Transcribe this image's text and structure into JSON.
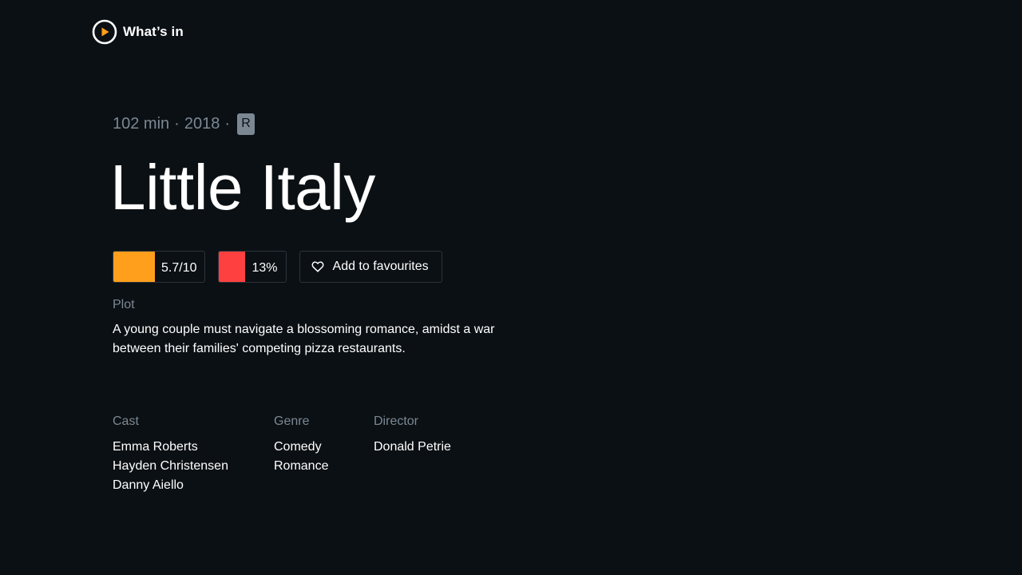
{
  "app": {
    "name": "What’s in",
    "colors": {
      "background": "#0b1014",
      "accent": "#ff9f1c",
      "muted": "#7b8894"
    }
  },
  "movie": {
    "runtime": "102 min",
    "separator1": "·",
    "year": "2018",
    "separator2": "·",
    "rating": "R",
    "title": "Little Italy",
    "imdb": {
      "value": "5.7/10",
      "color": "#ff9f1c"
    },
    "rotten": {
      "value": "13%",
      "color": "#ff4040"
    },
    "favourite_label": "Add to favourites",
    "plot_label": "Plot",
    "plot": "A young couple must navigate a blossoming romance, amidst a war between their families' competing pizza restaurants.",
    "cast_label": "Cast",
    "cast": [
      "Emma Roberts",
      "Hayden Christensen",
      "Danny Aiello"
    ],
    "genre_label": "Genre",
    "genres": [
      "Comedy",
      "Romance"
    ],
    "director_label": "Director",
    "directors": [
      "Donald Petrie"
    ]
  },
  "icons": {
    "logo": "play-circle-icon",
    "favourite": "heart-icon"
  }
}
